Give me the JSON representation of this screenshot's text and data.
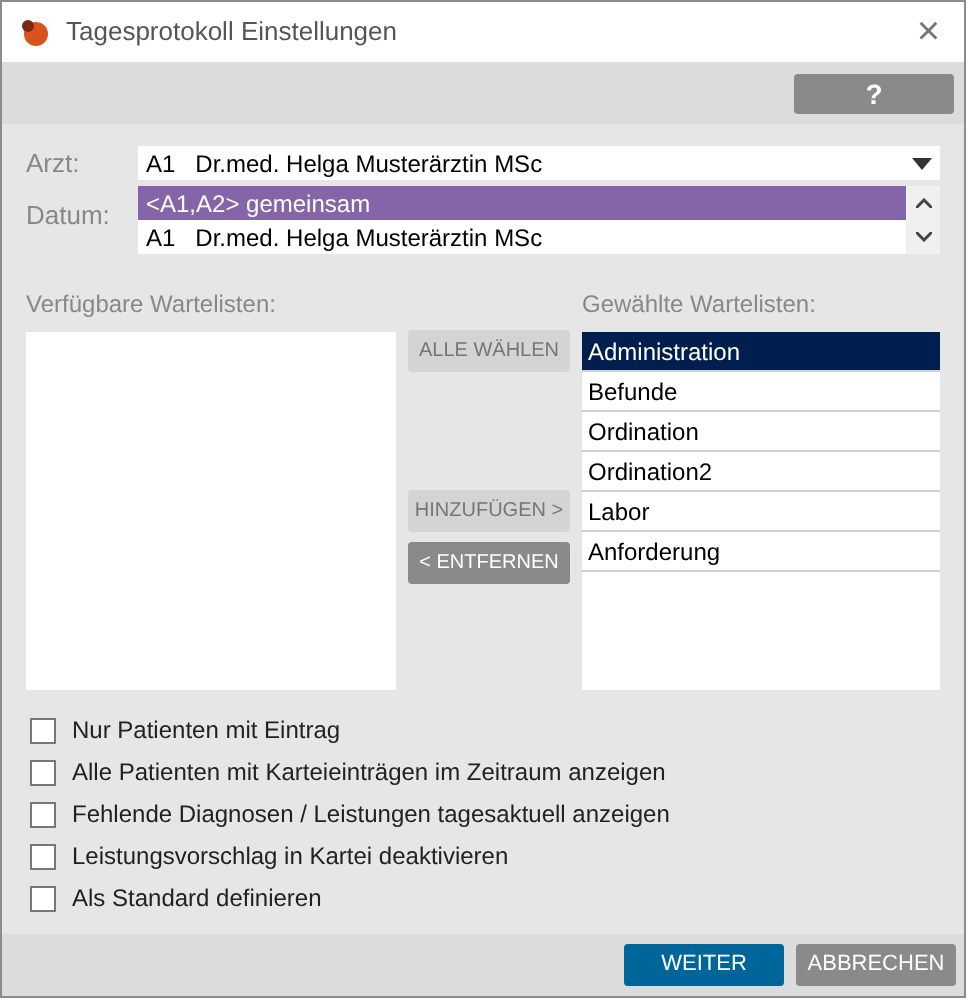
{
  "window": {
    "title": "Tagesprotokoll Einstellungen",
    "close": "×"
  },
  "toolbar": {
    "help": "?"
  },
  "form": {
    "arzt_label": "Arzt:",
    "arzt_value": "A1   Dr.med. Helga Musterärztin MSc",
    "datum_label": "Datum:",
    "dropdown_options": [
      {
        "label": "<A1,A2> gemeinsam",
        "selected": true
      },
      {
        "label": "A1   Dr.med. Helga Musterärztin MSc",
        "selected": false
      }
    ]
  },
  "available": {
    "label": "Verfügbare Wartelisten:"
  },
  "transfer_buttons": [
    {
      "label": "ALLE WÄHLEN",
      "disabled": true
    },
    {
      "label": "HINZUFÜGEN >",
      "disabled": true
    },
    {
      "label": "< ENTFERNEN",
      "disabled": false
    }
  ],
  "chosen": {
    "label": "Gewählte Wartelisten:",
    "items": [
      {
        "label": "Administration",
        "selected": true
      },
      {
        "label": "Befunde",
        "selected": false
      },
      {
        "label": "Ordination",
        "selected": false
      },
      {
        "label": "Ordination2",
        "selected": false
      },
      {
        "label": "Labor",
        "selected": false
      },
      {
        "label": "Anforderung",
        "selected": false
      }
    ]
  },
  "options": [
    {
      "label": "Nur Patienten mit Eintrag",
      "checked": false
    },
    {
      "label": "Alle Patienten mit Karteieinträgen im Zeitraum anzeigen",
      "checked": false
    },
    {
      "label": "Fehlende Diagnosen / Leistungen tagesaktuell anzeigen",
      "checked": false
    },
    {
      "label": "Leistungsvorschlag in Kartei deaktivieren",
      "checked": false
    },
    {
      "label": "Als Standard definieren",
      "checked": false
    }
  ],
  "footer": {
    "buttons": [
      {
        "label": "WEITER",
        "kind": "primary"
      },
      {
        "label": "ABBRECHEN",
        "kind": "secondary"
      }
    ]
  }
}
